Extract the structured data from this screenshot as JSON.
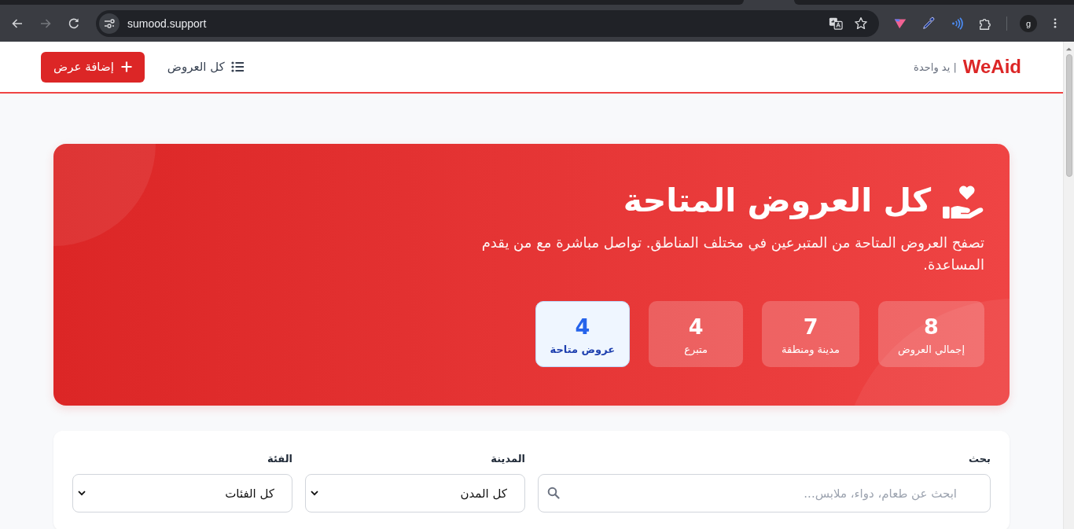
{
  "browser": {
    "nav_buttons": [
      {
        "kind": "back",
        "disabled": false
      },
      {
        "kind": "forward",
        "disabled": true
      },
      {
        "kind": "reload",
        "disabled": false
      }
    ],
    "url": "sumood.support",
    "profile": "g"
  },
  "navbar": {
    "logo": "WeAid",
    "tagline": "| يد واحدة",
    "items": [
      {
        "kind": "link",
        "label": "كل العروض"
      },
      {
        "kind": "button",
        "label": "إضافة عرض"
      }
    ]
  },
  "hero": {
    "title": "كل العروض المتاحة",
    "subtitle": "تصفح العروض المتاحة من المتبرعين في مختلف المناطق. تواصل مباشرة مع من يقدم المساعدة.",
    "stats": [
      {
        "value": "8",
        "label": "إجمالي العروض",
        "selected": false
      },
      {
        "value": "7",
        "label": "مدينة ومنطقة",
        "selected": false
      },
      {
        "value": "4",
        "label": "متبرع",
        "selected": false
      },
      {
        "value": "4",
        "label": "عروض متاحة",
        "selected": true
      }
    ]
  },
  "filters": {
    "fields": [
      {
        "kind": "search",
        "label": "بحث",
        "placeholder": "ابحث عن طعام، دواء، ملابس..."
      },
      {
        "kind": "select",
        "label": "المدينة",
        "value": "كل المدن"
      },
      {
        "kind": "select",
        "label": "الفئة",
        "value": "كل الفئات"
      }
    ]
  }
}
